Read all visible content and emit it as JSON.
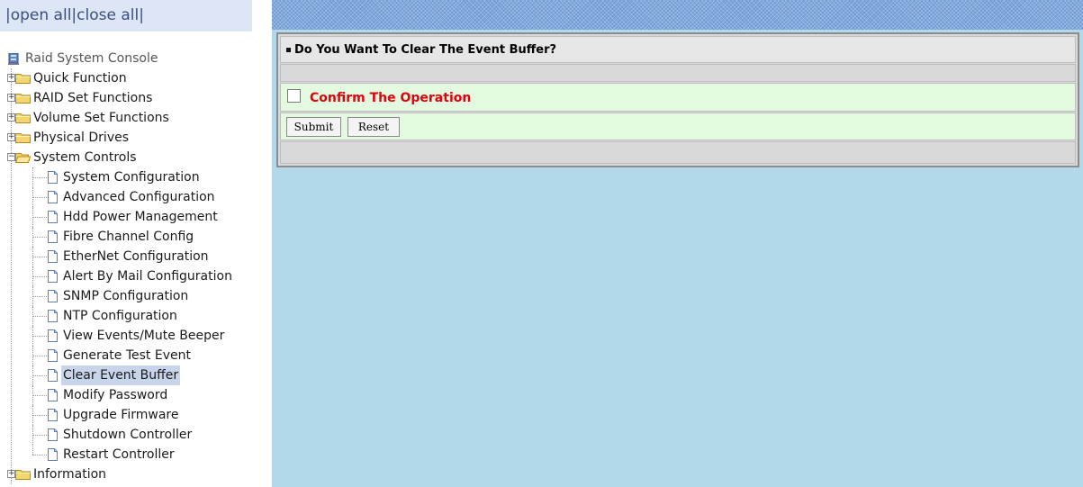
{
  "left_frame": {
    "open_all": "|open all",
    "close_all": "|close all|",
    "root": "Raid System Console",
    "folders": [
      {
        "label": "Quick Function",
        "expanded": false
      },
      {
        "label": "RAID Set Functions",
        "expanded": false
      },
      {
        "label": "Volume Set Functions",
        "expanded": false
      },
      {
        "label": "Physical Drives",
        "expanded": false
      },
      {
        "label": "System Controls",
        "expanded": true
      },
      {
        "label": "Information",
        "expanded": false
      }
    ],
    "system_controls_items": [
      "System Configuration",
      "Advanced Configuration",
      "Hdd Power Management",
      "Fibre Channel Config",
      "EtherNet Configuration",
      "Alert By Mail Configuration",
      "SNMP Configuration",
      "NTP Configuration",
      "View Events/Mute Beeper",
      "Generate Test Event",
      "Clear Event Buffer",
      "Modify Password",
      "Upgrade Firmware",
      "Shutdown Controller",
      "Restart Controller"
    ],
    "selected_item": "Clear Event Buffer"
  },
  "main": {
    "title": "Do You Want To Clear The Event Buffer?",
    "confirm_label": "Confirm The Operation",
    "confirm_checked": false,
    "submit_label": "Submit",
    "reset_label": "Reset"
  },
  "colors": {
    "content_background": "#b2d8e9",
    "confirm_text": "#e3000f",
    "form_row_background": "#e4fae0",
    "selected_background": "#c8d4ea"
  }
}
